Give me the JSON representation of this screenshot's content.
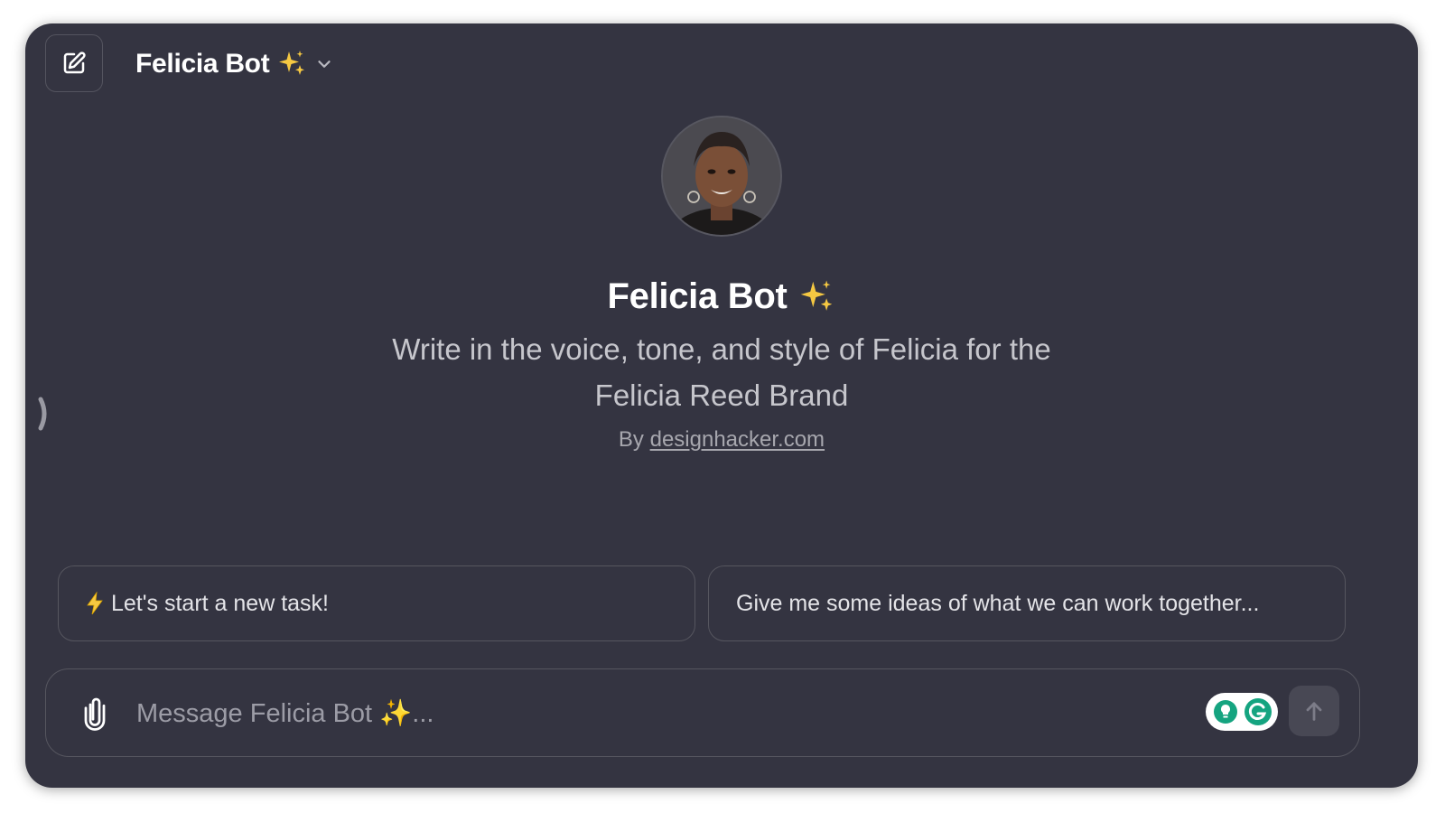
{
  "header": {
    "model_name": "Felicia Bot",
    "new_chat_icon": "edit-pencil-icon",
    "dropdown_icon": "chevron-down-icon"
  },
  "bot": {
    "name": "Felicia Bot",
    "description": "Write in the voice, tone, and style of Felicia for the Felicia Reed Brand",
    "author_prefix": "By",
    "author_link": "designhacker.com"
  },
  "starters": [
    {
      "label": "Let's start a new task!",
      "icon": "lightning-bolt-icon"
    },
    {
      "label": "Give me some ideas of what we can work together..."
    }
  ],
  "composer": {
    "placeholder": "Message Felicia Bot ✨...",
    "attach_icon": "paperclip-icon",
    "send_icon": "arrow-up-icon",
    "extension": "grammarly-icon"
  },
  "colors": {
    "background": "#343441",
    "sparkle": "#f5c842",
    "grammarly_green": "#15a480"
  }
}
